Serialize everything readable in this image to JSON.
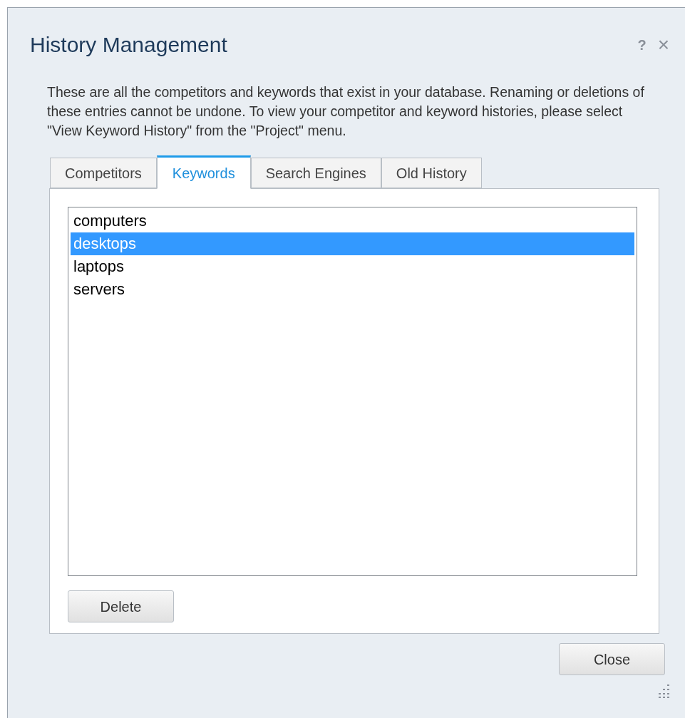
{
  "window": {
    "title": "History Management",
    "help": "?",
    "close": "×"
  },
  "description": "These are all the competitors and keywords that exist in your database.  Renaming or deletions of these entries cannot be undone.  To view your competitor and keyword histories, please select \"View Keyword History\" from the \"Project\" menu.",
  "tabs": [
    {
      "label": "Competitors",
      "selected": false
    },
    {
      "label": "Keywords",
      "selected": true
    },
    {
      "label": "Search Engines",
      "selected": false
    },
    {
      "label": "Old History",
      "selected": false
    }
  ],
  "list": [
    {
      "label": "computers",
      "selected": false
    },
    {
      "label": "desktops",
      "selected": true
    },
    {
      "label": "laptops",
      "selected": false
    },
    {
      "label": "servers",
      "selected": false
    }
  ],
  "delete_button": "Delete",
  "close_button": "Close"
}
